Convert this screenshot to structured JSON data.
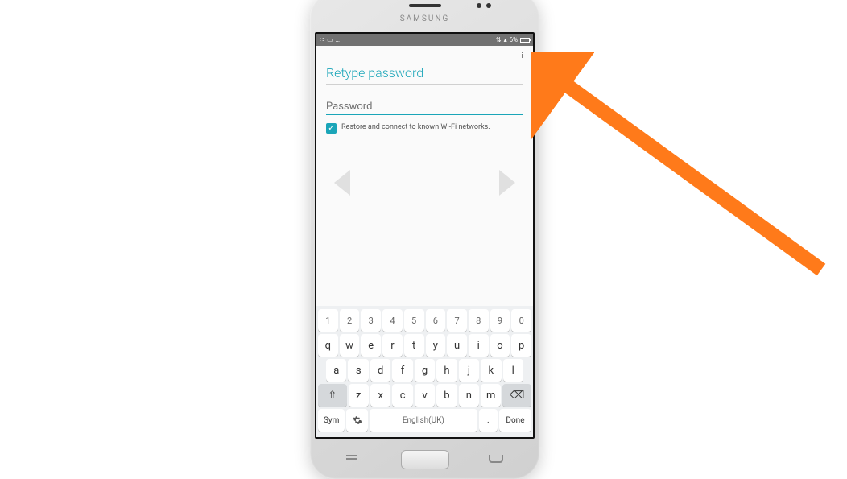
{
  "phone": {
    "brand": "SAMSUNG"
  },
  "statusbar": {
    "battery_text": "6%",
    "signal_icon": "▴",
    "wifi_icon": "⇅"
  },
  "screen": {
    "title": "Retype password",
    "password_label": "Password",
    "checkbox_label": "Restore and connect to known Wi-Fi networks.",
    "checkbox_checked": true
  },
  "keyboard": {
    "row_num": [
      "1",
      "2",
      "3",
      "4",
      "5",
      "6",
      "7",
      "8",
      "9",
      "0"
    ],
    "row_q": [
      "q",
      "w",
      "e",
      "r",
      "t",
      "y",
      "u",
      "i",
      "o",
      "p"
    ],
    "row_a": [
      "a",
      "s",
      "d",
      "f",
      "g",
      "h",
      "j",
      "k",
      "l"
    ],
    "row_z": [
      "z",
      "x",
      "c",
      "v",
      "b",
      "n",
      "m"
    ],
    "shift": "⇧",
    "backspace": "⌫",
    "sym": "Sym",
    "gear": "⚙",
    "space": "English(UK)",
    "period": ".",
    "done": "Done"
  },
  "annotation": {
    "arrow_color": "#ff7a1a"
  }
}
